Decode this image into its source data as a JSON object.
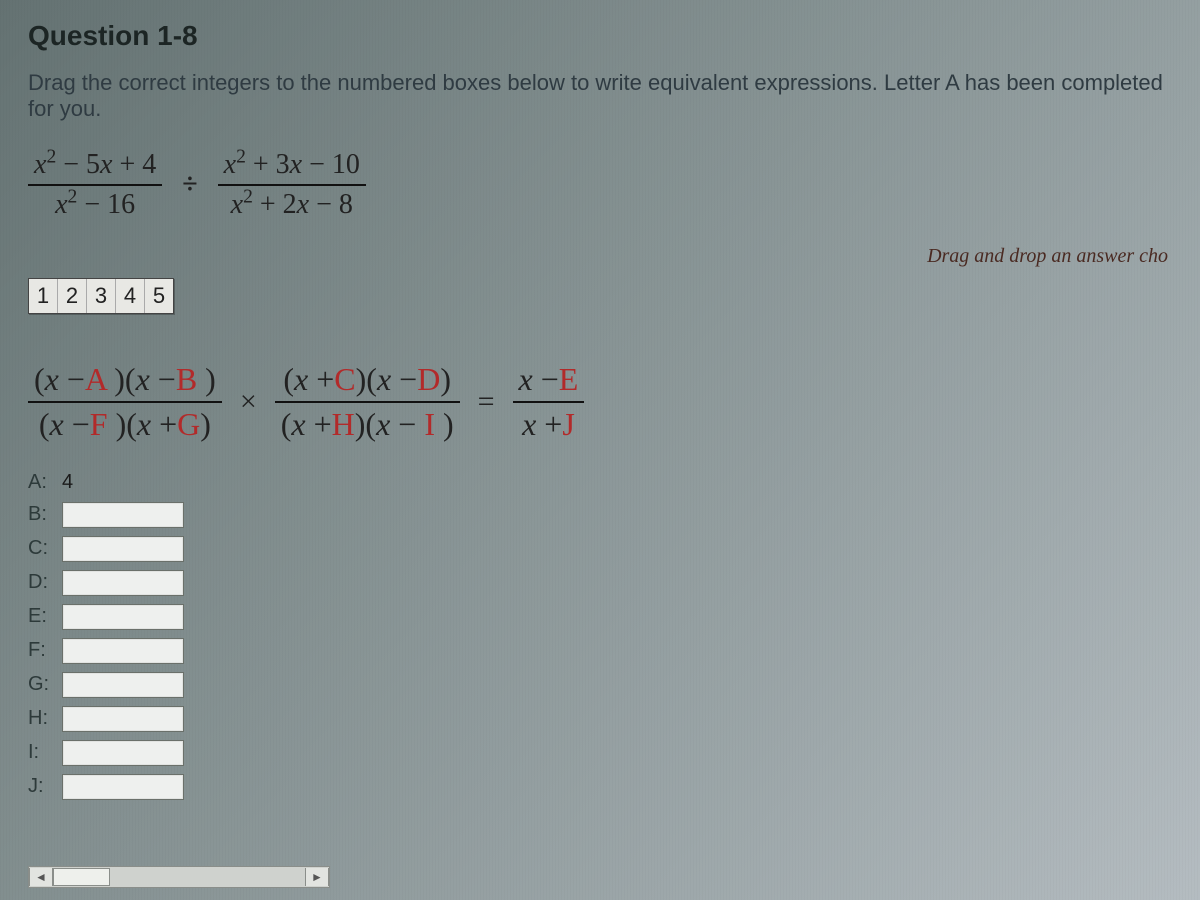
{
  "question_label": "Question 1-8",
  "instruction": "Drag the correct integers to the numbered boxes below to write equivalent expressions. Letter A has been completed for you.",
  "problem": {
    "frac1_num": "x² − 5x + 4",
    "frac1_den": "x² − 16",
    "op": "÷",
    "frac2_num": "x² + 3x − 10",
    "frac2_den": "x² + 2x − 8"
  },
  "hint": "Drag and drop an answer cho",
  "palette": [
    "1",
    "2",
    "3",
    "4",
    "5"
  ],
  "equation": {
    "p1": "(x −",
    "A": "A",
    "p2": " )(x −",
    "B": "B",
    "p3": " )",
    "p4": "(x −",
    "F": "F",
    "p5": " )(x +",
    "G": "G",
    "p6": ")",
    "mult": "×",
    "q1": "(x +",
    "C": "C",
    "q2": ")(x −",
    "D": "D",
    "q3": ")",
    "q4": "(x +",
    "H": "H",
    "q5": ")(x −",
    "I": "I",
    "q6": " )",
    "eq": "=",
    "r1": "x −",
    "E": "E",
    "r2": "x +",
    "J": "J"
  },
  "answers": [
    {
      "label": "A:",
      "value": "4",
      "filled": true
    },
    {
      "label": "B:",
      "value": "",
      "filled": false
    },
    {
      "label": "C:",
      "value": "",
      "filled": false
    },
    {
      "label": "D:",
      "value": "",
      "filled": false
    },
    {
      "label": "E:",
      "value": "",
      "filled": false
    },
    {
      "label": "F:",
      "value": "",
      "filled": false
    },
    {
      "label": "G:",
      "value": "",
      "filled": false
    },
    {
      "label": "H:",
      "value": "",
      "filled": false
    },
    {
      "label": "I:",
      "value": "",
      "filled": false
    },
    {
      "label": "J:",
      "value": "",
      "filled": false
    }
  ]
}
